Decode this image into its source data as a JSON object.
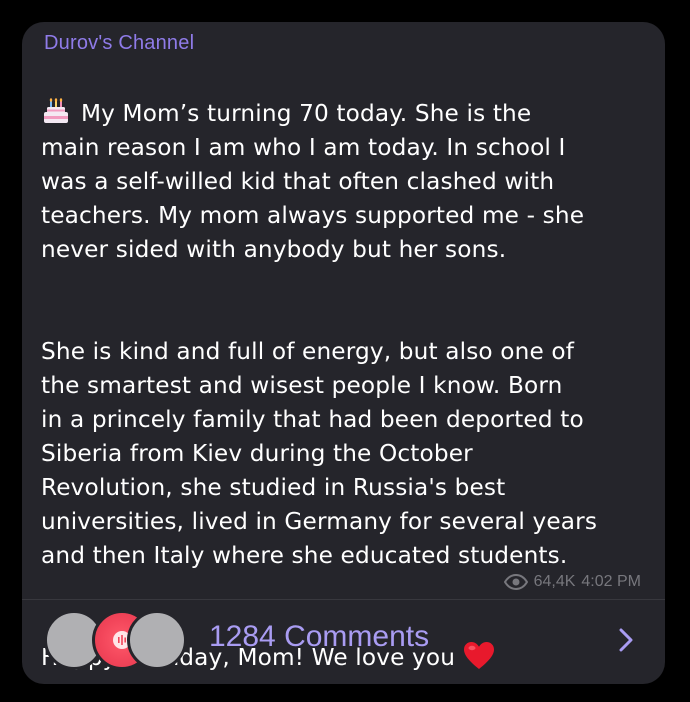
{
  "post": {
    "channel_name": "Durov's Channel",
    "paragraphs": [
      "My Mom’s turning 70 today. She is the\nmain reason I am who I am today. In school I\nwas a self-willed kid that often clashed with\nteachers. My mom always supported me - she\nnever sided with anybody but her sons.",
      "She is kind and full of energy, but also one of\nthe smartest and wisest people I know. Born\nin a princely family that had been deported to\nSiberia from Kiev during the October\nRevolution, she studied in Russia's best\nuniversities, lived in Germany for several years\nand then Italy where she educated students.",
      "Happy birthday, Mom! We love you"
    ],
    "leading_emoji": "cake-icon",
    "trailing_emoji": "heart-icon",
    "views": "64,4K",
    "time": "4:02 PM"
  },
  "comments": {
    "label": "1284 Comments",
    "icon": "chevron-right-icon"
  },
  "colors": {
    "bubble": "#25252b",
    "accent": "#8f7be8",
    "comments_text": "#a99cf2",
    "meta": "#77777d",
    "heart": "#e8192c"
  }
}
